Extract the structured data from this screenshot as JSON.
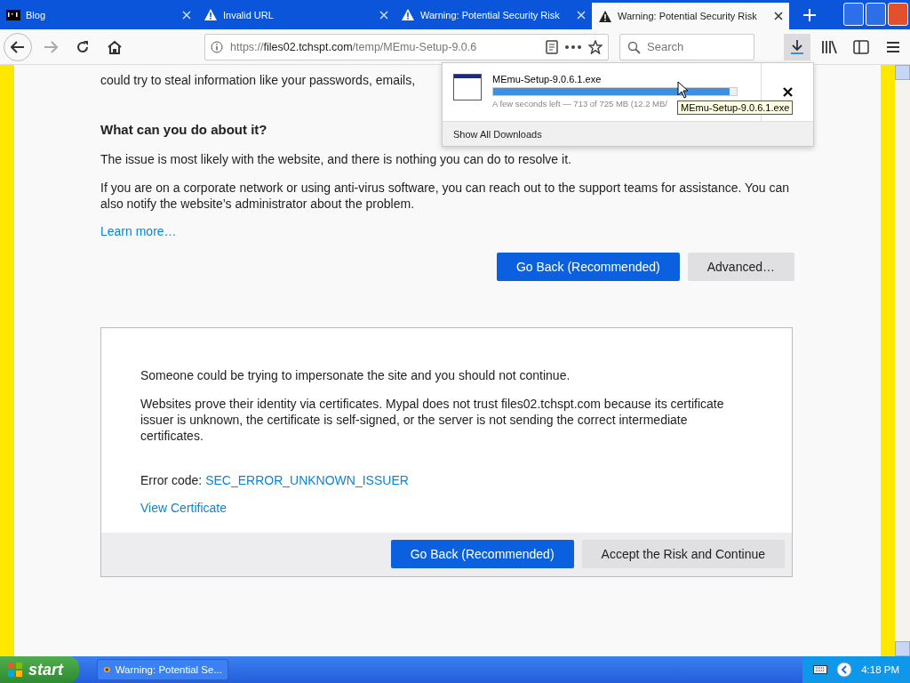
{
  "tabs": [
    {
      "title": "Blog",
      "selected": false
    },
    {
      "title": "Invalid URL",
      "selected": false
    },
    {
      "title": "Warning: Potential Security Risk",
      "selected": false
    },
    {
      "title": "Warning: Potential Security Risk",
      "selected": true
    }
  ],
  "address_bar": {
    "scheme": "https://",
    "host": "files02.tchspt.com",
    "path": "/temp/MEmu-Setup-9.0.6"
  },
  "search": {
    "placeholder": "Search"
  },
  "downloads_panel": {
    "file": "MEmu-Setup-9.0.6.1.exe",
    "level": 0.97,
    "status": "A few seconds left — 713 of 725 MB (12.2 MB/",
    "footer": "Show All Downloads",
    "tooltip": "MEmu-Setup-9.0.6.1.exe"
  },
  "page": {
    "intro": "could try to steal information like your passwords, emails,",
    "heading": "What can you do about it?",
    "paragraphs": [
      "The issue is most likely with the website, and there is nothing you can do to resolve it.",
      "If you are on a corporate network or using anti-virus software, you can reach out to the support teams for assistance. You can also notify the website’s administrator about the problem."
    ],
    "learn_more": "Learn more…",
    "buttons": [
      {
        "label": "Go Back (Recommended)",
        "kind": "primary"
      },
      {
        "label": "Advanced…",
        "kind": "secondary"
      }
    ]
  },
  "advanced": {
    "paragraphs": [
      "Someone could be trying to impersonate the site and you should not continue.",
      "Websites prove their identity via certificates. Mypal does not trust files02.tchspt.com because its certificate issuer is unknown, the certificate is self-signed, or the server is not sending the correct intermediate certificates."
    ],
    "error_label": "Error code:",
    "error_code": "SEC_ERROR_UNKNOWN_ISSUER",
    "view_certificate": "View Certificate",
    "buttons": [
      {
        "label": "Go Back (Recommended)",
        "kind": "primary"
      },
      {
        "label": "Accept the Risk and Continue",
        "kind": "secondary"
      }
    ]
  },
  "taskbar": {
    "start": "start",
    "tasks": [
      {
        "title": "Warning: Potential Se...",
        "selected": false
      }
    ],
    "clock": "4:18 PM"
  }
}
